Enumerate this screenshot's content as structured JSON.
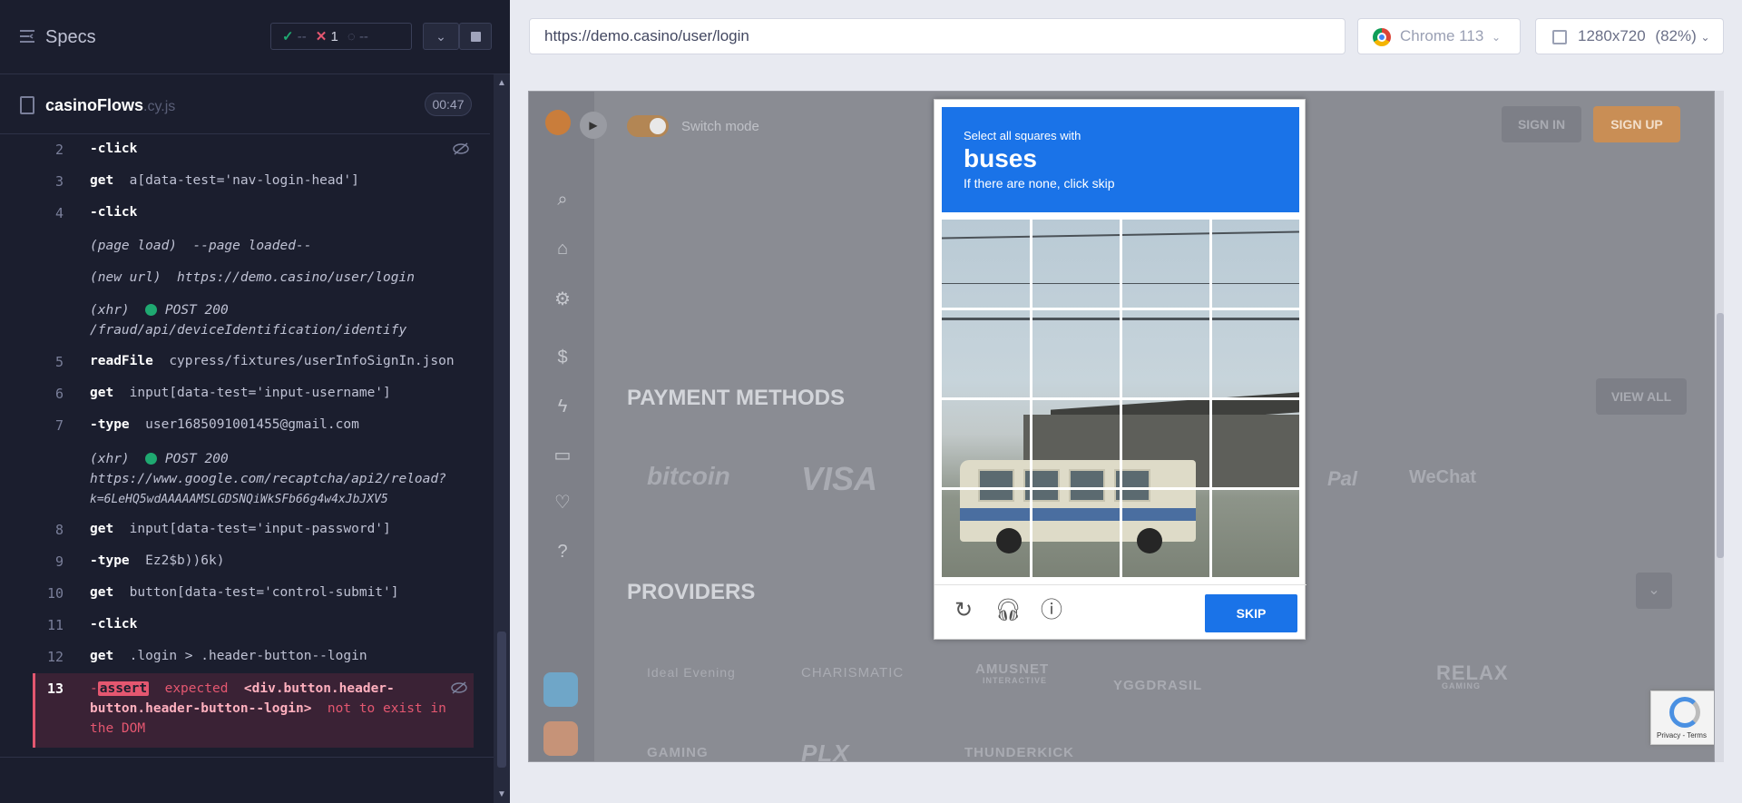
{
  "runner": {
    "specs_label": "Specs",
    "stats": {
      "passed": "--",
      "failed": "1",
      "pending": "--"
    },
    "file": {
      "name": "casinoFlows",
      "ext": ".cy.js",
      "duration": "00:47"
    },
    "commands": [
      {
        "num": "2",
        "cmd": "-click",
        "arg": ""
      },
      {
        "num": "3",
        "cmd": "get",
        "arg": "a[data-test='nav-login-head']"
      },
      {
        "num": "4",
        "cmd": "-click",
        "arg": ""
      },
      {
        "num": "",
        "meta1": "(page load)",
        "meta2": "--page loaded--"
      },
      {
        "num": "",
        "meta1": "(new url)",
        "meta2": "https://demo.casino/user/login"
      },
      {
        "num": "",
        "meta1": "(xhr)",
        "meta2": "POST 200",
        "meta3": "/fraud/api/deviceIdentification/identify"
      },
      {
        "num": "5",
        "cmd": "readFile",
        "arg": "cypress/fixtures/userInfoSignIn.json"
      },
      {
        "num": "6",
        "cmd": "get",
        "arg": "input[data-test='input-username']"
      },
      {
        "num": "7",
        "cmd": "-type",
        "arg": "user1685091001455@gmail.com"
      },
      {
        "num": "",
        "meta1": "(xhr)",
        "meta2": "POST 200",
        "meta3": "https://www.google.com/recaptcha/api2/reload?",
        "meta4": "k=6LeHQ5wdAAAAAMSLGDSNQiWkSFb66g4w4xJbJXV5"
      },
      {
        "num": "8",
        "cmd": "get",
        "arg": "input[data-test='input-password']"
      },
      {
        "num": "9",
        "cmd": "-type",
        "arg": "Ez2$b))6k)"
      },
      {
        "num": "10",
        "cmd": "get",
        "arg": "button[data-test='control-submit']"
      },
      {
        "num": "11",
        "cmd": "-click",
        "arg": ""
      },
      {
        "num": "12",
        "cmd": "get",
        "arg": ".login > .header-button--login"
      }
    ],
    "error": {
      "num": "13",
      "prefix": "-",
      "assert": "assert",
      "expected": "expected",
      "subject": "<div.button.header-",
      "subject2": "button.header-button--login>",
      "tail": "not to exist in",
      "tail2": "the DOM"
    }
  },
  "browser": {
    "url": "https://demo.casino/user/login",
    "name": "Chrome 113",
    "viewport": "1280x720",
    "zoom": "(82%)"
  },
  "app": {
    "switch_mode": "Switch mode",
    "sign_in": "SIGN IN",
    "sign_up": "SIGN UP",
    "payment_title": "PAYMENT METHODS",
    "view_all": "VIEW ALL",
    "providers_title": "PROVIDERS",
    "payments": [
      "bitcoin",
      "VISA",
      "Pal",
      "WeChat"
    ],
    "providers": [
      "Ideal Evening",
      "CHARISMATIC",
      "AMUSNET",
      "INTERACTIVE",
      "YGGDRASIL",
      "RELAX",
      "GAMING",
      "GAMING",
      "PLX",
      "THUNDERKICK"
    ]
  },
  "captcha": {
    "instruction": "Select all squares with",
    "target": "buses",
    "hint": "If there are none, click skip",
    "skip": "SKIP",
    "badge": "Privacy - Terms"
  }
}
